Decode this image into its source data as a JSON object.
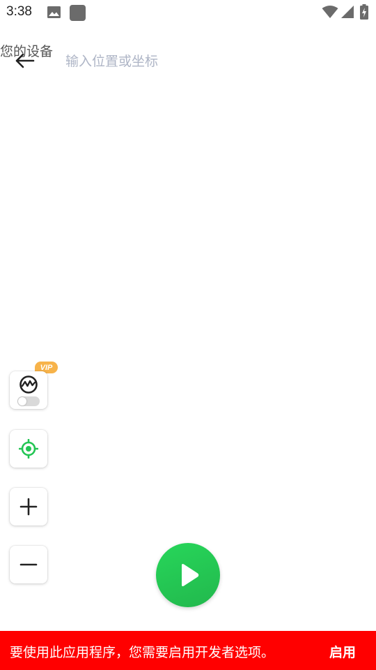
{
  "status_bar": {
    "time": "3:38",
    "icons": [
      "image-icon",
      "app-notification-icon",
      "wifi-icon",
      "cell-signal-icon",
      "battery-charging-icon"
    ]
  },
  "header": {
    "device_label": "您的设备",
    "back_icon": "arrow-left-icon",
    "search": {
      "placeholder": "输入位置或坐标",
      "value": ""
    }
  },
  "controls": {
    "vip_badge": "VIP",
    "sim_icon": "route-simulation-icon",
    "locate_icon": "crosshair-locate-icon",
    "zoom_in_icon": "plus-icon",
    "zoom_out_icon": "minus-icon",
    "play_icon": "play-icon",
    "toggle_on": false
  },
  "banner": {
    "message": "要使用此应用程序，您需要启用开发者选项。",
    "action": "启用"
  },
  "colors": {
    "accent_green": "#22c553",
    "banner_red": "#ff0000",
    "vip_orange": "#f7b34a",
    "placeholder": "#aeb5c6"
  }
}
